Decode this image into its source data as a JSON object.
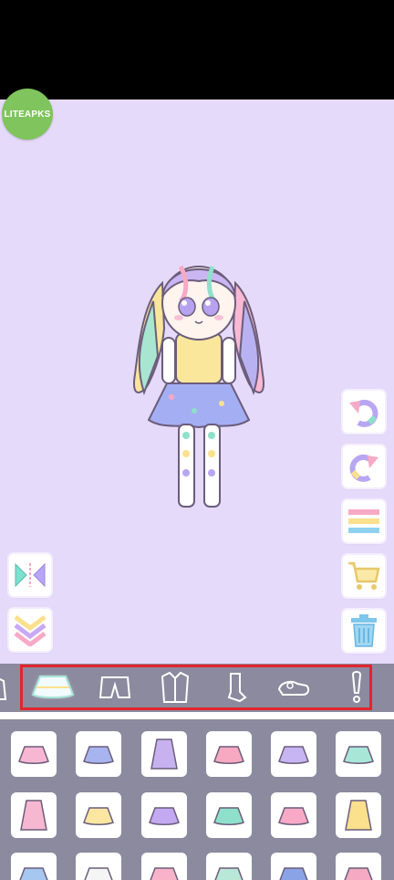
{
  "app": {
    "badge_text": "LITEAPKS"
  },
  "colors": {
    "background": "#e6dafb",
    "category_bar": "#8c8a9e",
    "highlight_border": "#e2252d",
    "button_bg": "#ffffff"
  },
  "side_buttons": {
    "left": [
      "flip-icon",
      "collapse-icon"
    ],
    "right": [
      "undo-icon",
      "redo-icon",
      "list-icon",
      "cart-icon",
      "trash-icon"
    ]
  },
  "categories": [
    {
      "name": "top-icon"
    },
    {
      "name": "skirt-icon",
      "selected": true
    },
    {
      "name": "shorts-icon"
    },
    {
      "name": "outfit-icon"
    },
    {
      "name": "socks-icon"
    },
    {
      "name": "shoes-icon"
    },
    {
      "name": "accessory-icon"
    }
  ],
  "items": [
    {
      "name": "rainbow-ruffle-skirt",
      "color": "#f7b6d2"
    },
    {
      "name": "blue-tutu-skirt",
      "color": "#a7b4f0"
    },
    {
      "name": "purple-long-skirt",
      "color": "#c7b2ef"
    },
    {
      "name": "pink-pleated-skirt",
      "color": "#f6a9c1"
    },
    {
      "name": "rainbow-stripe-skirt",
      "color": "#c6b5f2"
    },
    {
      "name": "mint-tiered-skirt",
      "color": "#a8e6d8"
    },
    {
      "name": "pastel-long-stripe-skirt",
      "color": "#f6b8d0"
    },
    {
      "name": "yellow-flare-skirt",
      "color": "#fbe7a1"
    },
    {
      "name": "lavender-mini-skirt",
      "color": "#c2a9f2"
    },
    {
      "name": "mint-star-skirt",
      "color": "#8fe0cb"
    },
    {
      "name": "pink-stripe-skirt",
      "color": "#f7a9c6"
    },
    {
      "name": "yellow-long-pleated-skirt",
      "color": "#fbe08d"
    },
    {
      "name": "blue-skirt-partial",
      "color": "#a5c7f0"
    },
    {
      "name": "white-skirt-partial",
      "color": "#f5f5f5"
    },
    {
      "name": "pink-skirt-partial",
      "color": "#f8b3cb"
    },
    {
      "name": "rainbow-skirt-partial",
      "color": "#b9e7d8"
    },
    {
      "name": "navy-skirt-partial",
      "color": "#8aa3e6"
    },
    {
      "name": "pink-check-skirt-partial",
      "color": "#f5a9c2"
    }
  ]
}
